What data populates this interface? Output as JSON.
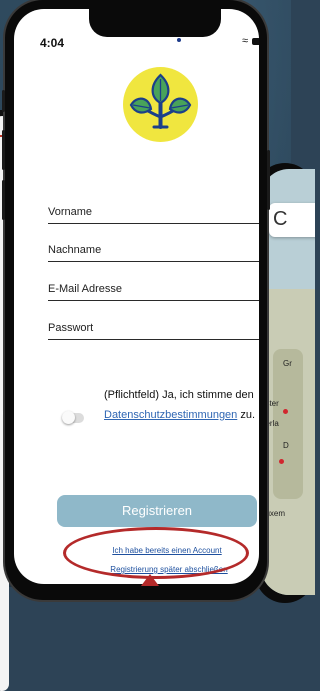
{
  "status_bar": {
    "time": "4:04"
  },
  "form": {
    "first_name": "Vorname",
    "last_name": "Nachname",
    "email": "E-Mail Adresse",
    "password": "Passwort"
  },
  "consent": {
    "text_prefix": "(Pflichtfeld) Ja, ich stimme den",
    "link": "Datenschutzbestimmungen",
    "text_suffix": " zu."
  },
  "actions": {
    "register": "Registrieren",
    "have_account": "Ich habe bereits einen Account",
    "later": "Registrierung später abschließen"
  },
  "map": {
    "search_glyph": "C",
    "labels": [
      "Gr",
      "nster",
      "derla",
      "D",
      "Luxem"
    ]
  },
  "colors": {
    "logo_bg": "#f0e63f",
    "leaf": "#48a35a",
    "stem": "#1b3f8a",
    "button": "#8fb8c9",
    "link": "#1d4f9e",
    "highlight": "#b42a2a"
  }
}
